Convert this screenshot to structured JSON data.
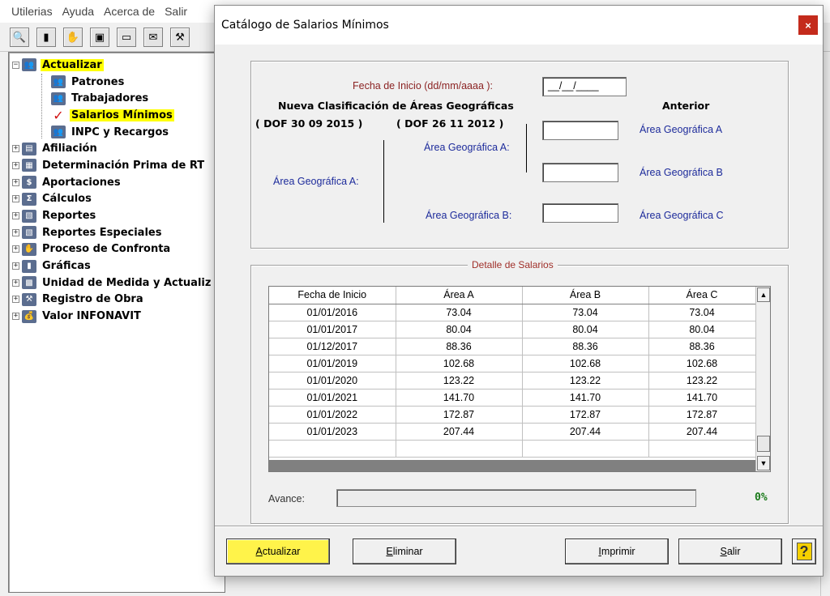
{
  "menu": [
    "Utilerias",
    "Ayuda",
    "Acerca de",
    "Salir"
  ],
  "toolbar_icons": [
    "search-icon",
    "chart-icon",
    "handshake-icon",
    "save-icon",
    "minimize-icon",
    "stamp-icon",
    "tools-icon"
  ],
  "tree": [
    {
      "label": "Actualizar",
      "expander": "−",
      "icon": "group-icon",
      "level": 0,
      "highlight": true
    },
    {
      "label": "Patrones",
      "expander": "",
      "icon": "group-icon",
      "level": 1,
      "highlight": false
    },
    {
      "label": "Trabajadores",
      "expander": "",
      "icon": "group-icon",
      "level": 1,
      "highlight": false
    },
    {
      "label": "Salarios Mínimos",
      "expander": "",
      "icon": "check-icon",
      "level": 1,
      "highlight": true
    },
    {
      "label": "INPC y Recargos",
      "expander": "",
      "icon": "group-icon",
      "level": 1,
      "highlight": false
    },
    {
      "label": "Afiliación",
      "expander": "+",
      "icon": "document-icon",
      "level": 0,
      "highlight": false
    },
    {
      "label": "Determinación Prima de RT",
      "expander": "+",
      "icon": "chart-icon",
      "level": 0,
      "highlight": false
    },
    {
      "label": "Aportaciones",
      "expander": "+",
      "icon": "dollar-icon",
      "level": 0,
      "highlight": false
    },
    {
      "label": "Cálculos",
      "expander": "+",
      "icon": "sigma-icon",
      "level": 0,
      "highlight": false
    },
    {
      "label": "Reportes",
      "expander": "+",
      "icon": "report-icon",
      "level": 0,
      "highlight": false
    },
    {
      "label": "Reportes Especiales",
      "expander": "+",
      "icon": "report-icon",
      "level": 0,
      "highlight": false
    },
    {
      "label": "Proceso de Confronta",
      "expander": "+",
      "icon": "handshake-icon",
      "level": 0,
      "highlight": false
    },
    {
      "label": "Gráficas",
      "expander": "+",
      "icon": "bar-chart-icon",
      "level": 0,
      "highlight": false
    },
    {
      "label": "Unidad de Medida y Actualiz",
      "expander": "+",
      "icon": "calculator-icon",
      "level": 0,
      "highlight": false
    },
    {
      "label": "Registro de Obra",
      "expander": "+",
      "icon": "tools-icon",
      "level": 0,
      "highlight": false
    },
    {
      "label": "Valor INFONAVIT",
      "expander": "+",
      "icon": "money-bag-icon",
      "level": 0,
      "highlight": false
    }
  ],
  "dialog": {
    "title": "Catálogo de Salarios Mínimos",
    "close": "×",
    "fecha_label": "Fecha de Inicio (dd/mm/aaaa ):",
    "fecha_value": "__/__/____",
    "nueva_title": "Nueva Clasificación de Áreas Geográficas",
    "anterior_title": "Anterior",
    "dof_2015": "( DOF 30 09 2015 )",
    "dof_2012": "( DOF 26 11 2012 )",
    "area_a_left": "Área Geográfica A:",
    "area_a_mid": "Área Geográfica A:",
    "area_b_mid": "Área Geográfica B:",
    "ant_a": "Área Geográfica A",
    "ant_b": "Área Geográfica B",
    "ant_c": "Área Geográfica C",
    "input_a": "",
    "input_mid": "",
    "input_b": "",
    "detalle_legend": "Detalle de Salarios",
    "columns": [
      "Fecha de Inicio",
      "Área A",
      "Área B",
      "Área C"
    ],
    "rows": [
      [
        "01/01/2016",
        "73.04",
        "73.04",
        "73.04"
      ],
      [
        "01/01/2017",
        "80.04",
        "80.04",
        "80.04"
      ],
      [
        "01/12/2017",
        "88.36",
        "88.36",
        "88.36"
      ],
      [
        "01/01/2019",
        "102.68",
        "102.68",
        "102.68"
      ],
      [
        "01/01/2020",
        "123.22",
        "123.22",
        "123.22"
      ],
      [
        "01/01/2021",
        "141.70",
        "141.70",
        "141.70"
      ],
      [
        "01/01/2022",
        "172.87",
        "172.87",
        "172.87"
      ],
      [
        "01/01/2023",
        "207.44",
        "207.44",
        "207.44"
      ]
    ],
    "avance_label": "Avance:",
    "progress_fraction": 0,
    "progress_text": "0%",
    "buttons": {
      "actualizar_ul": "A",
      "actualizar_rest": "ctualizar",
      "eliminar_ul": "E",
      "eliminar_rest": "liminar",
      "imprimir_ul": "I",
      "imprimir_rest": "mprimir",
      "salir_ul": "S",
      "salir_rest": "alir",
      "help": "?"
    }
  },
  "colors": {
    "highlight": "#ffff00",
    "primary_button": "#fff34a",
    "label_maroon": "#8b2323",
    "label_blue": "#1d2b9b",
    "progress_text": "#1a7a1a",
    "close": "#c42b1c"
  }
}
